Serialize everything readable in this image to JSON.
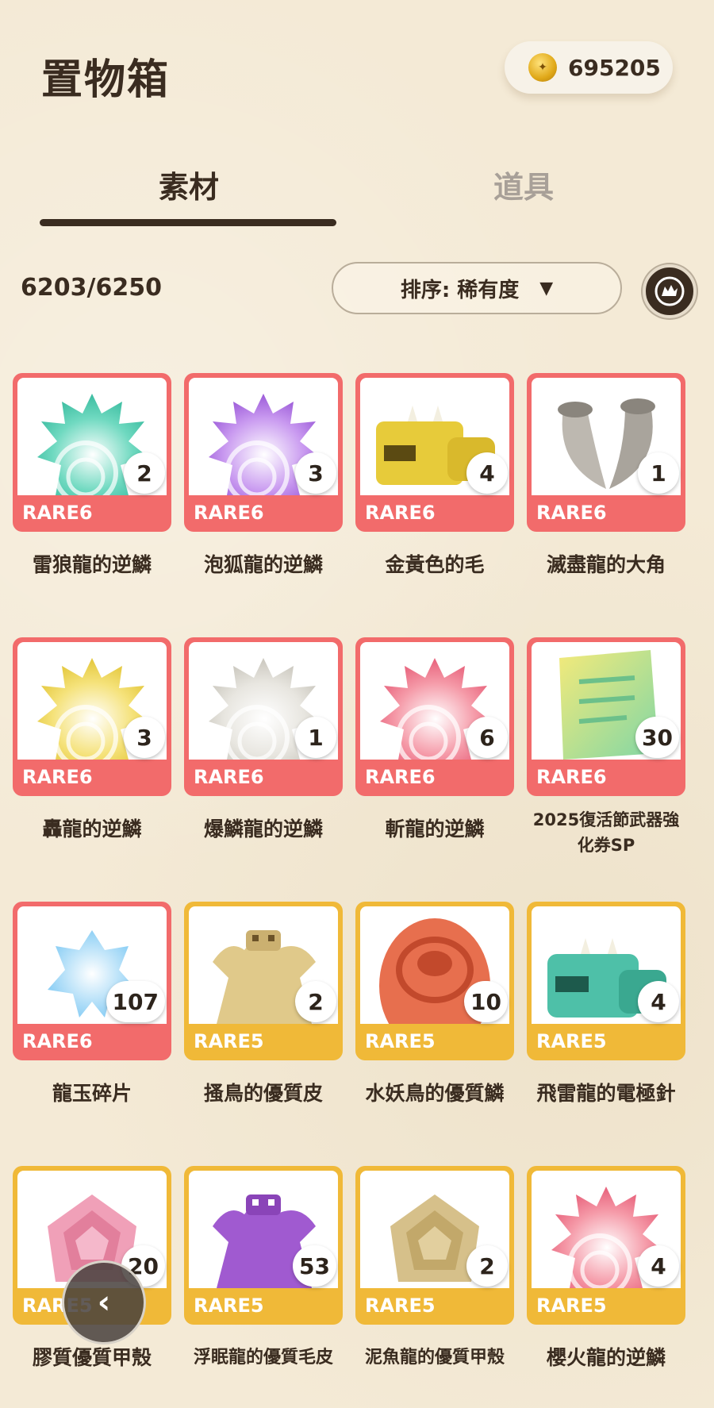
{
  "header": {
    "title": "置物箱",
    "coins": "695205"
  },
  "tabs": [
    {
      "label": "素材",
      "active": true
    },
    {
      "label": "道具",
      "active": false
    }
  ],
  "toolbar": {
    "count": "6203/6250",
    "sort_label": "排序: 稀有度",
    "sort_arrow": "▼"
  },
  "colors": {
    "rare6": "#f26b6b",
    "rare5": "#f0b938",
    "text": "#3a2c20"
  },
  "items": [
    {
      "name": "雷狼龍的逆鱗",
      "rarity": "RARE6",
      "qty": "2",
      "icon": "teal-scale-icon"
    },
    {
      "name": "泡狐龍的逆鱗",
      "rarity": "RARE6",
      "qty": "3",
      "icon": "purple-scale-icon"
    },
    {
      "name": "金黃色的毛",
      "rarity": "RARE6",
      "qty": "4",
      "icon": "gold-fur-icon"
    },
    {
      "name": "滅盡龍的大角",
      "rarity": "RARE6",
      "qty": "1",
      "icon": "horn-icon"
    },
    {
      "name": "轟龍的逆鱗",
      "rarity": "RARE6",
      "qty": "3",
      "icon": "yellow-scale-icon"
    },
    {
      "name": "爆鱗龍的逆鱗",
      "rarity": "RARE6",
      "qty": "1",
      "icon": "white-scale-icon"
    },
    {
      "name": "斬龍的逆鱗",
      "rarity": "RARE6",
      "qty": "6",
      "icon": "pink-scale-icon"
    },
    {
      "name": "2025復活節武器強化券SP",
      "rarity": "RARE6",
      "qty": "30",
      "icon": "ticket-icon"
    },
    {
      "name": "龍玉碎片",
      "rarity": "RARE6",
      "qty": "107",
      "icon": "gem-shard-icon"
    },
    {
      "name": "搔鳥的優質皮",
      "rarity": "RARE5",
      "qty": "2",
      "icon": "tan-hide-icon"
    },
    {
      "name": "水妖鳥的優質鱗",
      "rarity": "RARE5",
      "qty": "10",
      "icon": "orange-scale-icon"
    },
    {
      "name": "飛雷龍的電極針",
      "rarity": "RARE5",
      "qty": "4",
      "icon": "teal-fur-icon"
    },
    {
      "name": "膠質優質甲殼",
      "rarity": "RARE5",
      "qty": "20",
      "icon": "pink-shell-icon"
    },
    {
      "name": "浮眠龍的優質毛皮",
      "rarity": "RARE5",
      "qty": "53",
      "icon": "purple-hide-icon"
    },
    {
      "name": "泥魚龍的優質甲殼",
      "rarity": "RARE5",
      "qty": "2",
      "icon": "tan-shell-icon"
    },
    {
      "name": "櫻火龍的逆鱗",
      "rarity": "RARE5",
      "qty": "4",
      "icon": "pink-scale-icon"
    }
  ],
  "nav": {
    "back_label": "‹"
  }
}
